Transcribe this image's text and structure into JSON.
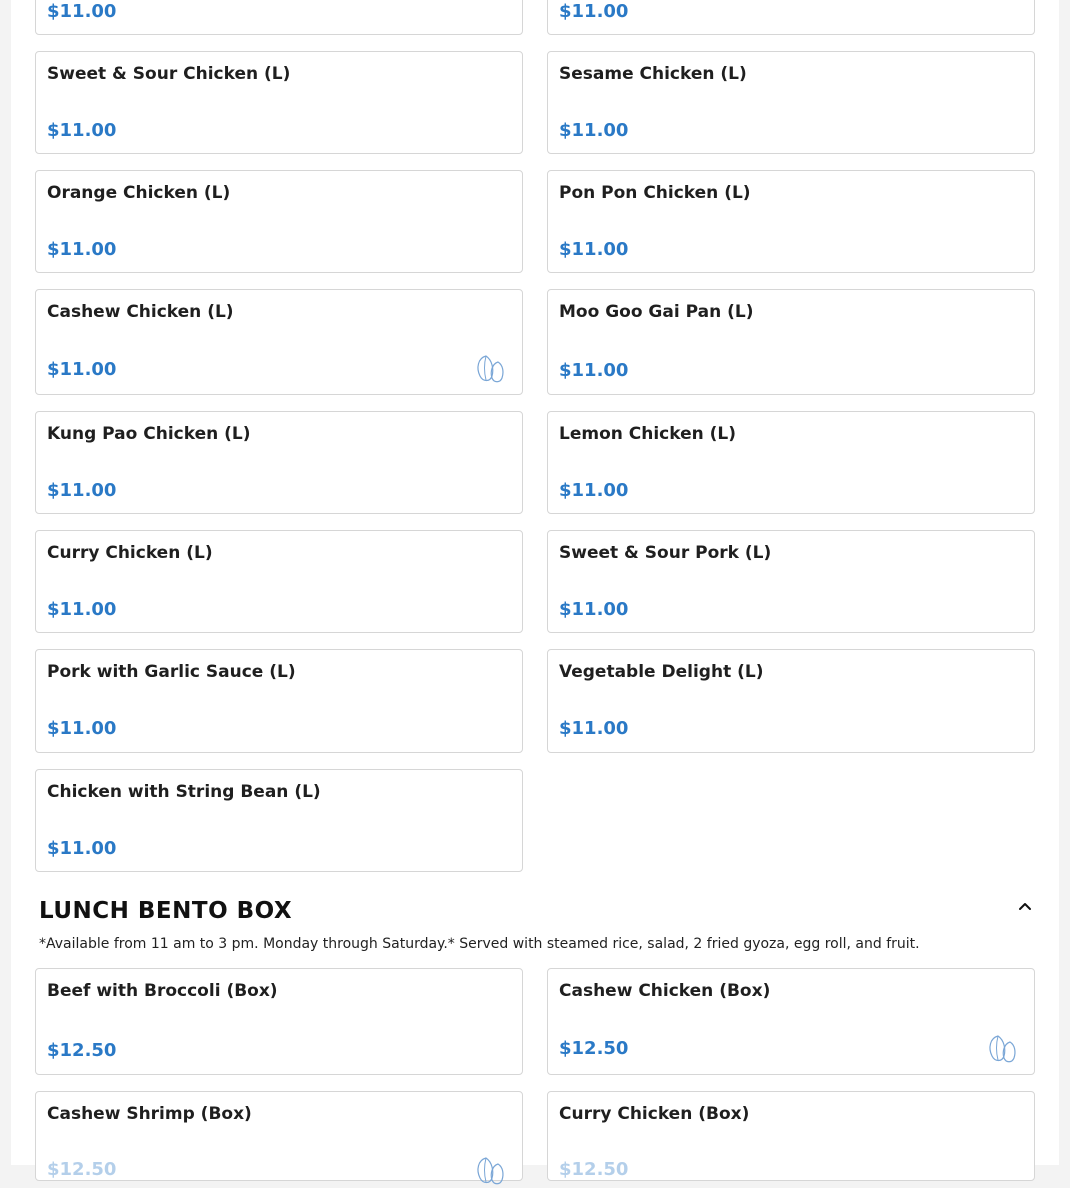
{
  "large_items_top": [
    {
      "price": "$11.00"
    },
    {
      "price": "$11.00"
    }
  ],
  "large_items": [
    {
      "name": "Sweet & Sour Chicken (L)",
      "price": "$11.00"
    },
    {
      "name": "Sesame Chicken (L)",
      "price": "$11.00"
    },
    {
      "name": "Orange Chicken (L)",
      "price": "$11.00"
    },
    {
      "name": "Pon Pon Chicken (L)",
      "price": "$11.00"
    },
    {
      "name": "Cashew Chicken (L)",
      "price": "$11.00",
      "icon": "nut-icon"
    },
    {
      "name": "Moo Goo Gai Pan (L)",
      "price": "$11.00"
    },
    {
      "name": "Kung Pao Chicken (L)",
      "price": "$11.00"
    },
    {
      "name": "Lemon Chicken (L)",
      "price": "$11.00"
    },
    {
      "name": "Curry Chicken (L)",
      "price": "$11.00"
    },
    {
      "name": "Sweet & Sour Pork (L)",
      "price": "$11.00"
    },
    {
      "name": "Pork with Garlic Sauce (L)",
      "price": "$11.00"
    },
    {
      "name": "Vegetable Delight (L)",
      "price": "$11.00"
    },
    {
      "name": "Chicken with String Bean (L)",
      "price": "$11.00"
    }
  ],
  "bento_section": {
    "title": "LUNCH BENTO BOX",
    "toggle_icon": "chevron-up-icon",
    "note": "*Available from 11 am to 3 pm. Monday through Saturday.* Served with steamed rice, salad, 2 fried gyoza, egg roll, and fruit.",
    "items": [
      {
        "name": "Beef with Broccoli (Box)",
        "price": "$12.50"
      },
      {
        "name": "Cashew Chicken (Box)",
        "price": "$12.50",
        "icon": "nut-icon"
      },
      {
        "name": "Cashew Shrimp (Box)",
        "price": "$12.50",
        "icon": "nut-icon"
      },
      {
        "name": "Curry Chicken (Box)",
        "price": "$12.50"
      }
    ]
  },
  "colors": {
    "price": "#2a79c6",
    "icon": "#7aa6d6"
  }
}
